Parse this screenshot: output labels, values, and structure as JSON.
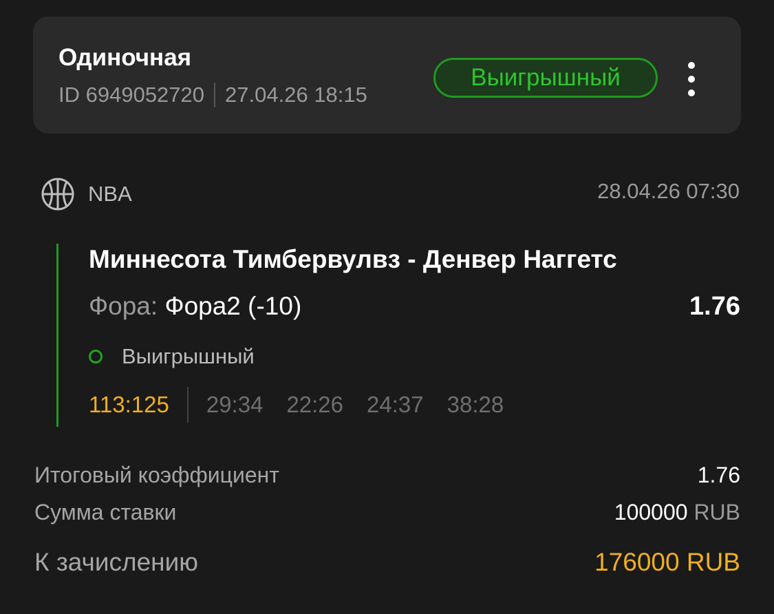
{
  "header": {
    "bet_type": "Одиночная",
    "bet_id": "ID 6949052720",
    "placed_at": "27.04.26 18:15",
    "status": "Выигрышный"
  },
  "icons": {
    "menu": "more-vertical-icon",
    "sport": "basketball-icon",
    "outcome": "circle-outline-icon"
  },
  "event": {
    "league": "NBA",
    "datetime": "28.04.26 07:30",
    "teams": "Миннесота Тимбервулвз - Денвер Наггетс",
    "market_label": "Фора:",
    "market_value": "Фора2 (-10)",
    "odds": "1.76",
    "outcome_status": "Выигрышный",
    "total_score": "113:125",
    "periods": [
      "29:34",
      "22:26",
      "24:37",
      "38:28"
    ]
  },
  "summary": {
    "total_odds_label": "Итоговый коэффициент",
    "total_odds_value": "1.76",
    "stake_label": "Сумма ставки",
    "stake_amount": "100000",
    "stake_currency": "RUB",
    "payout_label": "К зачислению",
    "payout_value": "176000 RUB"
  },
  "colors": {
    "background": "#1a1a1a",
    "card": "#2a2a2a",
    "win_green": "#2ec52e",
    "accent_gold": "#f2b01e"
  }
}
